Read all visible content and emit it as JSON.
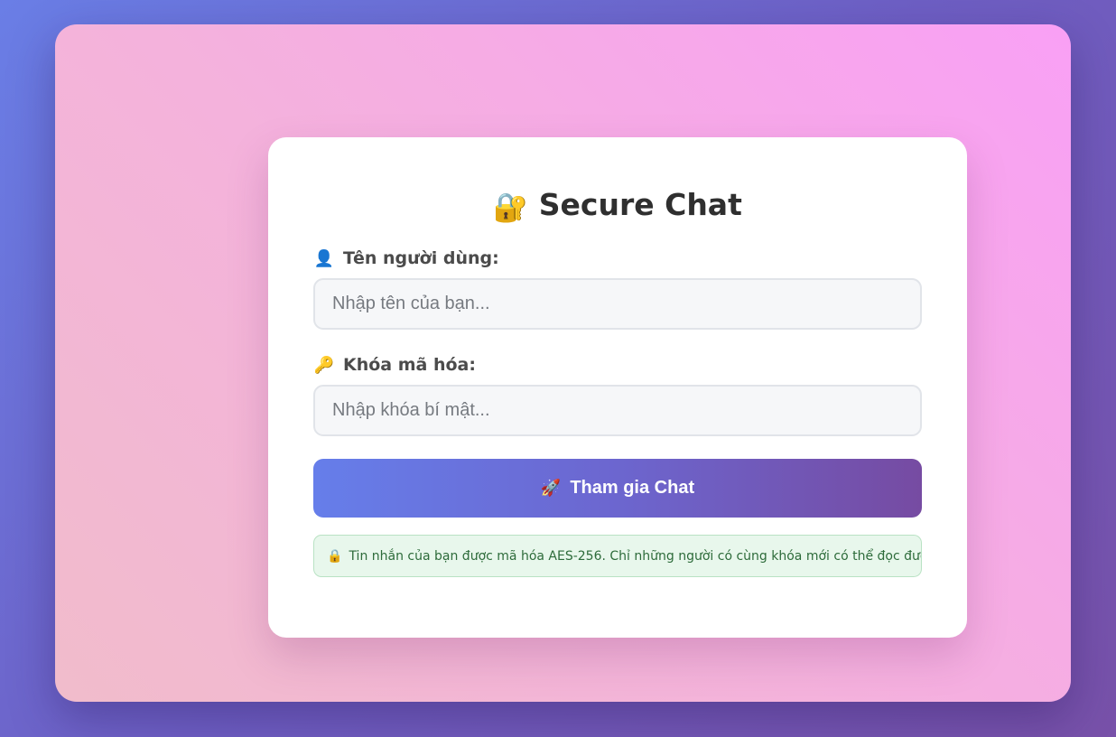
{
  "app": {
    "title": "Secure Chat",
    "title_icon": "🔐"
  },
  "form": {
    "username": {
      "icon": "👤",
      "label": "Tên người dùng:",
      "value": "",
      "placeholder": "Nhập tên của bạn..."
    },
    "key": {
      "icon": "🔑",
      "label": "Khóa mã hóa:",
      "value": "",
      "placeholder": "Nhập khóa bí mật..."
    },
    "join_button": {
      "icon": "🚀",
      "label": "Tham gia Chat"
    },
    "notice": {
      "icon": "🔒",
      "text": "Tin nhắn của bạn được mã hóa AES-256. Chỉ những người có cùng khóa mới có thể đọc được!"
    }
  },
  "colors": {
    "accent_start": "#667eea",
    "accent_end": "#764ba2",
    "notice_bg": "#e8f7ec",
    "notice_text": "#2d6b3a"
  }
}
